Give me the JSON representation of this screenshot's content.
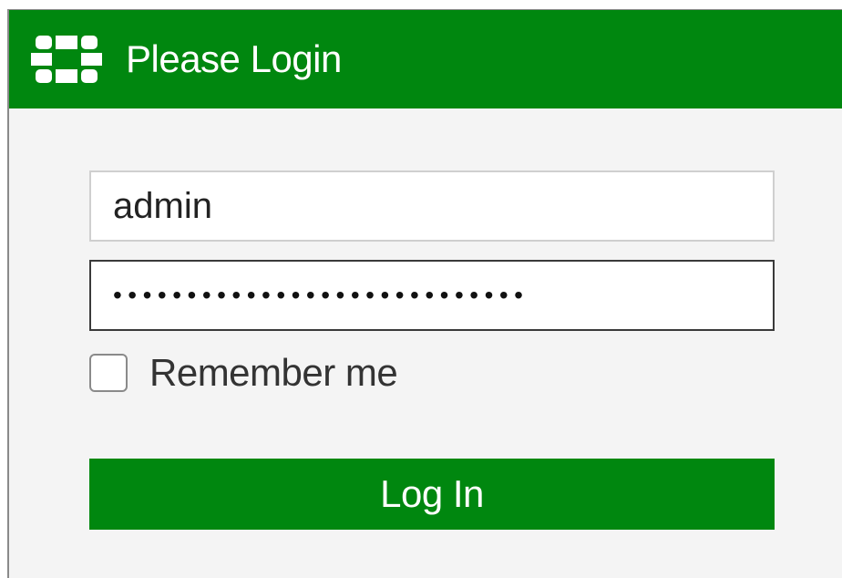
{
  "header": {
    "title": "Please Login",
    "icon": "fortinet-logo-icon",
    "color": "#00870f"
  },
  "form": {
    "username_value": "admin",
    "password_masked": "••••••••••••••••••••••••••••",
    "remember_label": "Remember me",
    "remember_checked": false,
    "login_label": "Log In"
  },
  "colors": {
    "accent": "#00870f",
    "panel_bg": "#f4f4f4"
  }
}
